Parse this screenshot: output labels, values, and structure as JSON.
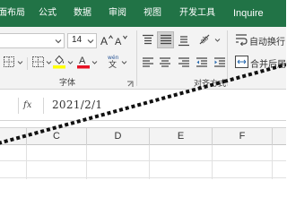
{
  "tabs": [
    "页面布局",
    "公式",
    "数据",
    "审阅",
    "视图",
    "开发工具",
    "Inquire"
  ],
  "tab_partial_visible": "面布局",
  "font": {
    "name_value": "",
    "size_value": "14",
    "grow_icon": "font-size-increase-icon",
    "shrink_icon": "font-size-decrease-icon",
    "group_label": "字体"
  },
  "alignment": {
    "wrap_text_label": "自动换行",
    "merge_center_label": "合并后居中",
    "group_label": "对齐方式"
  },
  "formula_bar": {
    "fx_label": "fx",
    "value": "2021/2/1"
  },
  "columns": [
    "C",
    "D",
    "E",
    "F"
  ],
  "colors": {
    "tabbar_bg": "#217346",
    "font_color_bar": "#e81123",
    "highlight_bar": "#ffff00"
  }
}
